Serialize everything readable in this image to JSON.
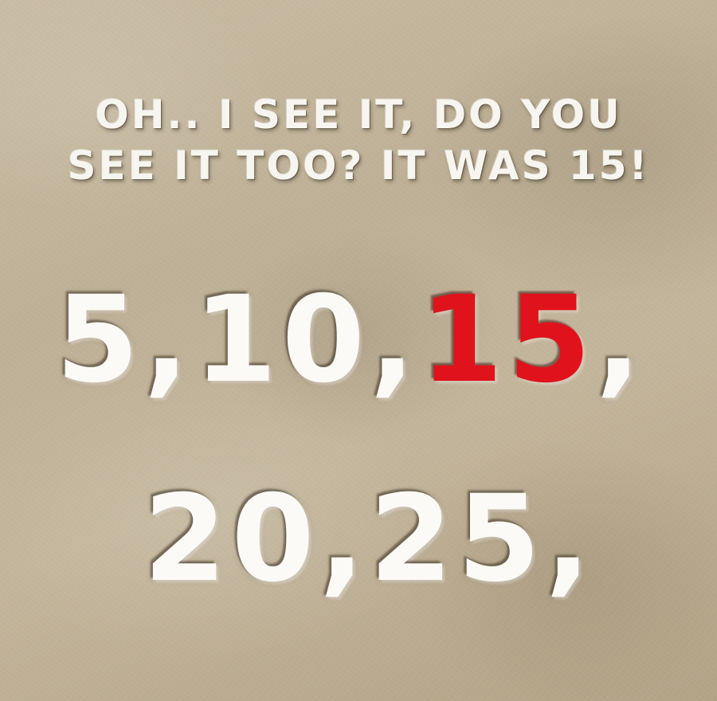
{
  "caption": {
    "line1": "OH.. I SEE IT, DO YOU",
    "line2": "SEE IT TOO? IT WAS 15!"
  },
  "sequence": {
    "row1": [
      {
        "text": "5,10,",
        "highlight": false
      },
      {
        "text": "15",
        "highlight": true
      },
      {
        "text": ",",
        "highlight": false
      }
    ],
    "row2": [
      {
        "text": "20,25,",
        "highlight": false
      }
    ]
  },
  "colors": {
    "highlight": "#e0121b",
    "text": "#fbfaf6"
  }
}
